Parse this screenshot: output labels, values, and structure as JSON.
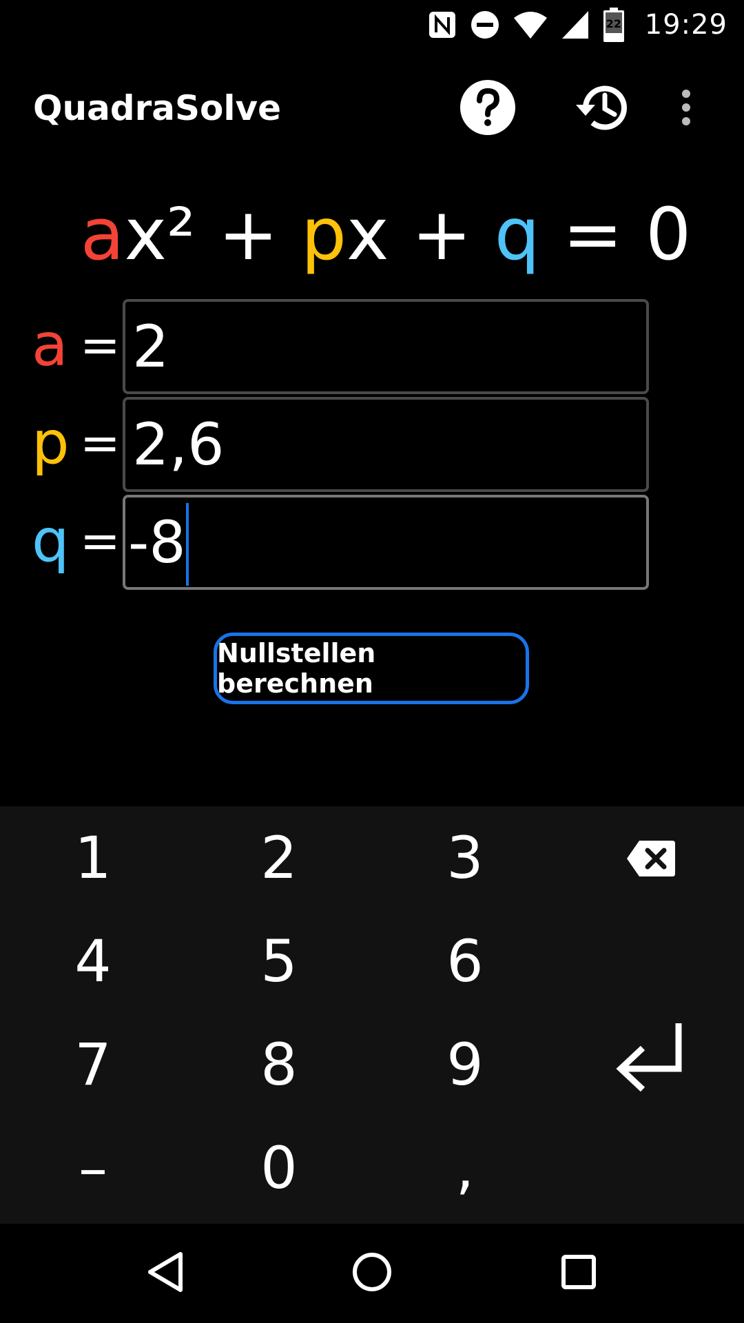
{
  "status_bar": {
    "time": "19:29",
    "battery_level": "22",
    "icons": [
      "nfc-icon",
      "do-not-disturb-icon",
      "wifi-icon",
      "cell-signal-icon",
      "battery-icon"
    ]
  },
  "app_bar": {
    "title": "QuadraSolve",
    "actions": [
      "help-icon",
      "history-icon",
      "more-vert-icon"
    ]
  },
  "equation": {
    "a": "a",
    "x2": "x² + ",
    "p": "p",
    "x": "x + ",
    "q": "q",
    "rhs": " = 0"
  },
  "inputs": [
    {
      "label": "a",
      "equals": "=",
      "value": "2",
      "color": "#f44336"
    },
    {
      "label": "p",
      "equals": "=",
      "value": "2,6",
      "color": "#fdc10a"
    },
    {
      "label": "q",
      "equals": "=",
      "value": "-8",
      "color": "#4fc3f7",
      "focused": true
    }
  ],
  "calculate_button": {
    "label": "Nullstellen berechnen"
  },
  "keypad": {
    "keys": [
      "1",
      "2",
      "3",
      "4",
      "5",
      "6",
      "7",
      "8",
      "9",
      "–",
      "0",
      ","
    ],
    "backspace": "backspace-icon",
    "enter": "enter-icon"
  },
  "colors": {
    "background": "#000000",
    "keypad_background": "#121212",
    "accent": "#1a73e8",
    "a_color": "#f44336",
    "p_color": "#fdc10a",
    "q_color": "#4fc3f7"
  },
  "nav_bar": {
    "buttons": [
      "back-icon",
      "home-icon",
      "recents-icon"
    ]
  }
}
